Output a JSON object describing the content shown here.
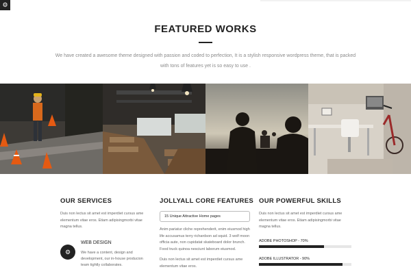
{
  "header": {
    "settings_icon": "gear-icon"
  },
  "hero": {
    "title": "FEATURED WORKS",
    "description": "We have created a awesome theme designed with passion and coded to perfection, It is a stylish responsive wordpress theme, that is packed with tons of features yet is so easy to use ."
  },
  "gallery": {
    "items": [
      {
        "name": "construction-worker-photo"
      },
      {
        "name": "office-hall-photo"
      },
      {
        "name": "sunset-silhouettes-photo"
      },
      {
        "name": "workspace-bicycle-photo"
      }
    ]
  },
  "services": {
    "title": "OUR SERVICES",
    "text": "Duis non lectus sit amet est imperdiet cursus ame elementum vitae eros. Etiam adipisingmorbi vitae magna tellus.",
    "item": {
      "icon": "cogs-icon",
      "title": "WEB DESIGN",
      "text": "We have a content, design and development, our in-house producion team tightly collaborates."
    }
  },
  "features": {
    "title": "JOLLYALL CORE FEATURES",
    "box_label": "15 Unique Attractive Home pages",
    "text1": "Anim pariatur cliche reprehenderit, enim eiusmod high life accusamus terry richardson ad squid. 3 wolf moon officia aute, non cupidatat skateboard dolor brunch. Food truck quinoa nesciunt laborum eiusmod.",
    "text2": "Duis non lectus sit amet est imperdiet cursus ame elementum vitae eros."
  },
  "skills": {
    "title": "OUR POWERFUL SKILLS",
    "text": "Duis non lectus sit amet est imperdiet cursus ame elementum vitae eros. Etiam adipisingmorbi vitae magna tellus.",
    "items": [
      {
        "label": "ADOBE PHOTOSHOP - 70%",
        "percent": 70
      },
      {
        "label": "ADOBE ILLUSTRATOR - 90%",
        "percent": 90
      }
    ]
  },
  "colors": {
    "accent": "#222222",
    "muted_text": "#8a8a8a",
    "track": "#e6e6e6"
  }
}
